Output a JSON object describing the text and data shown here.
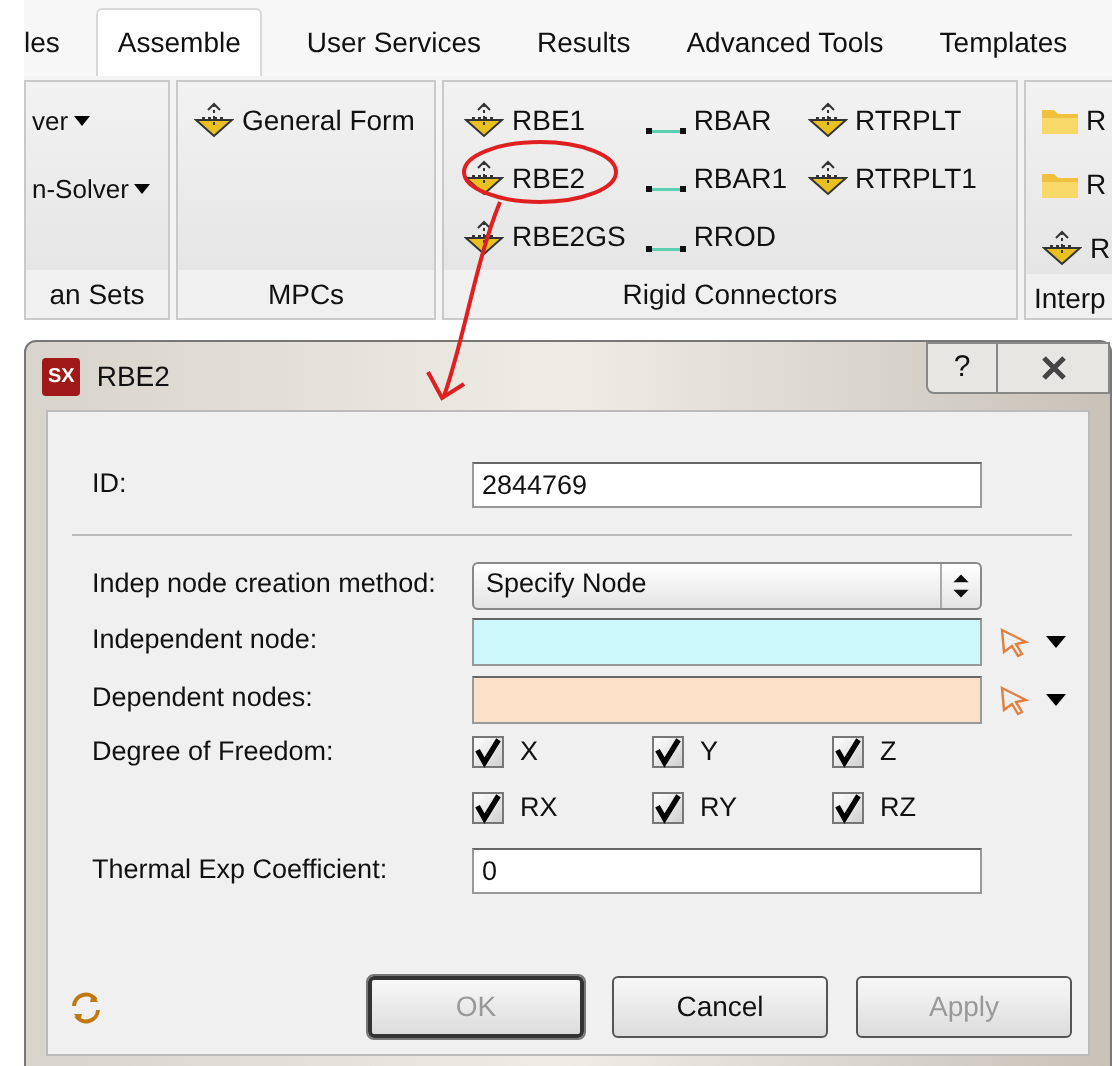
{
  "tabs": [
    {
      "label": "les",
      "selected": false
    },
    {
      "label": "Assemble",
      "selected": true
    },
    {
      "label": "User Services",
      "selected": false
    },
    {
      "label": "Results",
      "selected": false
    },
    {
      "label": "Advanced Tools",
      "selected": false
    },
    {
      "label": "Templates",
      "selected": false
    }
  ],
  "ribbon": {
    "groups": [
      {
        "label": "an Sets",
        "kind": "list",
        "items": [
          {
            "label": "ver",
            "kind": "dropdown"
          },
          {
            "label": "n-Solver",
            "kind": "dropdown"
          }
        ]
      },
      {
        "label": "MPCs",
        "kind": "list",
        "items": [
          {
            "label": "General Form",
            "kind": "connector"
          }
        ]
      },
      {
        "label": "Rigid Connectors",
        "kind": "grid",
        "items": [
          {
            "label": "RBE1",
            "kind": "connector"
          },
          {
            "label": "RBE2",
            "kind": "connector"
          },
          {
            "label": "RBE2GS",
            "kind": "connector"
          },
          {
            "label": "RBAR",
            "kind": "bar"
          },
          {
            "label": "RBAR1",
            "kind": "bar"
          },
          {
            "label": "RROD",
            "kind": "bar"
          },
          {
            "label": "RTRPLT",
            "kind": "connector"
          },
          {
            "label": "RTRPLT1",
            "kind": "connector"
          }
        ]
      },
      {
        "label": "Interp",
        "kind": "list",
        "items": [
          {
            "label": "R",
            "kind": "folder"
          },
          {
            "label": "R",
            "kind": "folder"
          },
          {
            "label": "R",
            "kind": "connector"
          }
        ]
      }
    ]
  },
  "dialog": {
    "app_badge": "SX",
    "title": "RBE2",
    "help": "?",
    "id": {
      "label": "ID:",
      "value": "2844769"
    },
    "method": {
      "label": "Indep node creation method:",
      "value": "Specify Node"
    },
    "node_fields": [
      {
        "label": "Independent node:",
        "color": "#ccf8fc"
      },
      {
        "label": "Dependent nodes:",
        "color": "#fde0c8"
      }
    ],
    "dof": {
      "label": "Degree of Freedom:",
      "options": [
        {
          "label": "X",
          "checked": true
        },
        {
          "label": "Y",
          "checked": true
        },
        {
          "label": "Z",
          "checked": true
        },
        {
          "label": "RX",
          "checked": true
        },
        {
          "label": "RY",
          "checked": true
        },
        {
          "label": "RZ",
          "checked": true
        }
      ]
    },
    "thermal": {
      "label": "Thermal Exp Coefficient:",
      "value": "0"
    },
    "buttons": [
      {
        "label": "OK",
        "disabled": true,
        "default": true
      },
      {
        "label": "Cancel",
        "disabled": false,
        "default": false
      },
      {
        "label": "Apply",
        "disabled": true,
        "default": false
      }
    ]
  }
}
